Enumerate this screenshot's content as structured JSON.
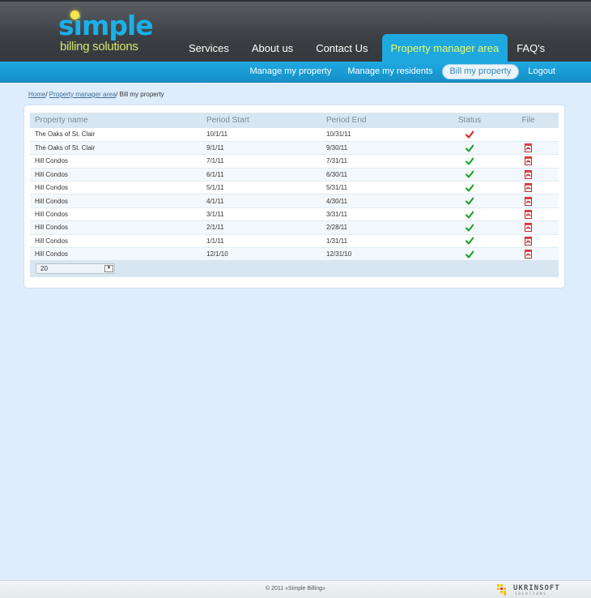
{
  "brand": {
    "logo_word": "simple",
    "logo_sub": "billing solutions"
  },
  "nav": [
    {
      "label": "Services",
      "active": false
    },
    {
      "label": "About us",
      "active": false
    },
    {
      "label": "Contact Us",
      "active": false
    },
    {
      "label": "Property manager area",
      "active": true
    },
    {
      "label": "FAQ's",
      "active": false
    }
  ],
  "subnav": [
    {
      "label": "Manage my property",
      "active": false
    },
    {
      "label": "Manage my residents",
      "active": false
    },
    {
      "label": "Bill my property",
      "active": true
    },
    {
      "label": "Logout",
      "active": false
    }
  ],
  "breadcrumb": {
    "home": "Home",
    "sep": "/ ",
    "area": "Property manager area",
    "current": "Bill my property"
  },
  "table": {
    "headers": [
      "Property name",
      "Period Start",
      "Period End",
      "Status",
      "File"
    ],
    "rows": [
      {
        "property": "The Oaks of St. Clair",
        "start": "10/1/11",
        "end": "10/31/11",
        "status": "pending",
        "file": false
      },
      {
        "property": "The Oaks of St. Clair",
        "start": "9/1/11",
        "end": "9/30/11",
        "status": "done",
        "file": true
      },
      {
        "property": "Hill Condos",
        "start": "7/1/11",
        "end": "7/31/11",
        "status": "done",
        "file": true
      },
      {
        "property": "Hill Condos",
        "start": "6/1/11",
        "end": "6/30/11",
        "status": "done",
        "file": true
      },
      {
        "property": "Hill Condos",
        "start": "5/1/11",
        "end": "5/31/11",
        "status": "done",
        "file": true
      },
      {
        "property": "Hill Condos",
        "start": "4/1/11",
        "end": "4/30/11",
        "status": "done",
        "file": true
      },
      {
        "property": "Hill Condos",
        "start": "3/1/11",
        "end": "3/31/11",
        "status": "done",
        "file": true
      },
      {
        "property": "Hill Condos",
        "start": "2/1/11",
        "end": "2/28/11",
        "status": "done",
        "file": true
      },
      {
        "property": "Hill Condos",
        "start": "1/1/11",
        "end": "1/31/11",
        "status": "done",
        "file": true
      },
      {
        "property": "Hill Condos",
        "start": "12/1/10",
        "end": "12/31/10",
        "status": "done",
        "file": true
      }
    ]
  },
  "pager": {
    "page_size": "20"
  },
  "footer": {
    "copyright": "© 2011 «Simple Billing»",
    "vendor_name": "UKRINSOFT",
    "vendor_sub": "SOLUTIONS"
  },
  "colors": {
    "done": "#22a22a",
    "pending": "#d22a2a",
    "accent": "#1ea8e0"
  }
}
